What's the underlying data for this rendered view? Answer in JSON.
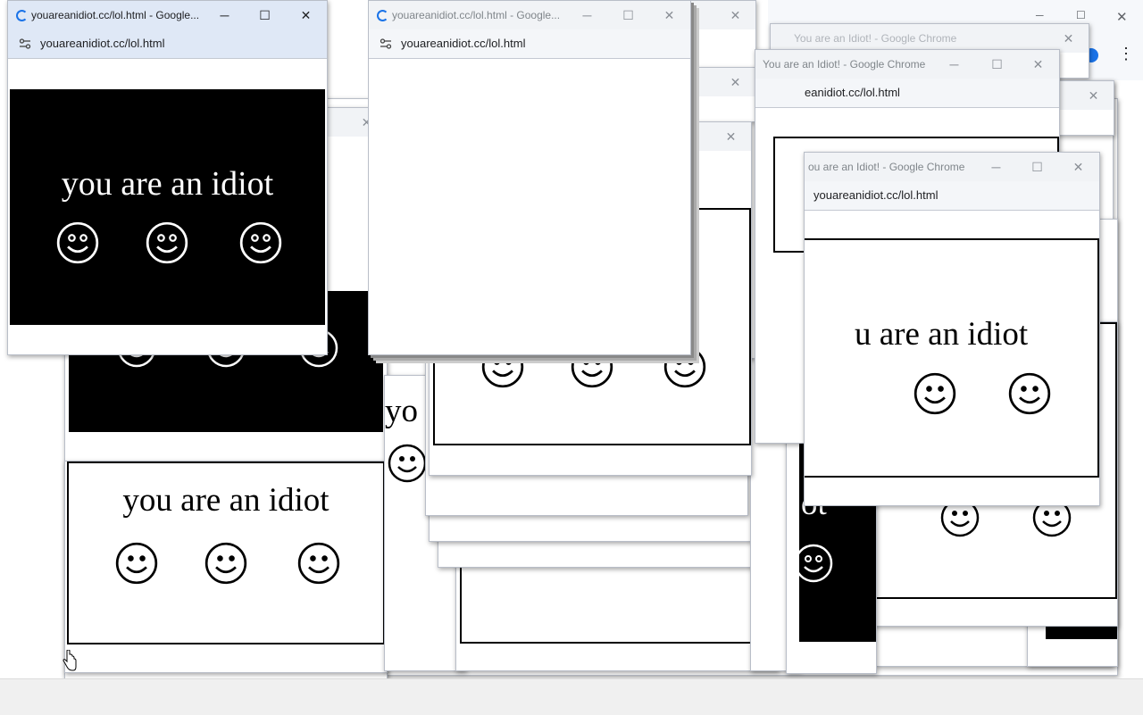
{
  "windows": {
    "main_title": "youareanidiot.cc/lol.html - Google...",
    "main_url": "youareanidiot.cc/lol.html",
    "second_title": "youareanidiot.cc/lol.html - Google...",
    "second_url": "youareanidiot.cc/lol.html",
    "right1_title": "You are an Idiot! - Google Chrome",
    "right1_url": "eanidiot.cc/lol.html",
    "right2_title": "ou are an Idiot! - Google Chrome",
    "right2_url": "youareanidiot.cc/lol.html",
    "faded_title": "You are an Idiot! - Google Chrome"
  },
  "controls": {
    "minimize": "─",
    "maximize": "☐",
    "close": "✕",
    "kebab": "⋮"
  },
  "content": {
    "phrase": "you are an idiot",
    "phrase_partial_right": "u are an idiot",
    "phrase_partial_ot": "ot",
    "phrase_partial_yo": "yo"
  },
  "colors": {
    "titlebar_active": "#dfe8f6",
    "close_red": "#e81123",
    "panel_black": "#000000",
    "panel_white": "#ffffff"
  },
  "icons": [
    "loading-spinner-icon",
    "tune-icon",
    "smiley-icon",
    "hand-cursor-icon",
    "profile-icon",
    "kebab-menu-icon"
  ]
}
